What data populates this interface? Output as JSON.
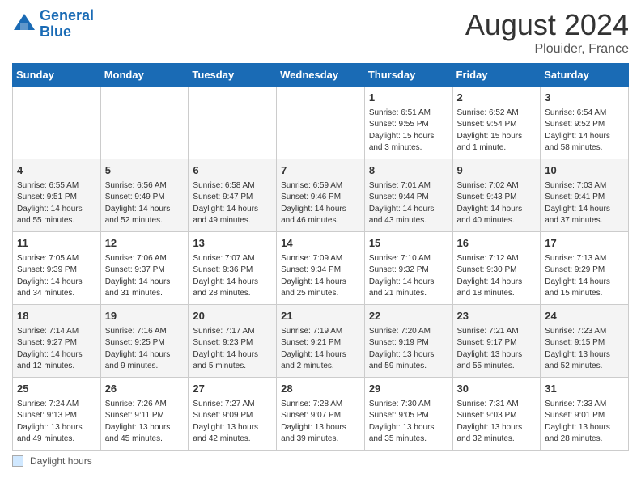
{
  "header": {
    "logo_line1": "General",
    "logo_line2": "Blue",
    "month_year": "August 2024",
    "location": "Plouider, France"
  },
  "legend": {
    "label": "Daylight hours"
  },
  "days_of_week": [
    "Sunday",
    "Monday",
    "Tuesday",
    "Wednesday",
    "Thursday",
    "Friday",
    "Saturday"
  ],
  "weeks": [
    [
      {
        "num": "",
        "info": ""
      },
      {
        "num": "",
        "info": ""
      },
      {
        "num": "",
        "info": ""
      },
      {
        "num": "",
        "info": ""
      },
      {
        "num": "1",
        "info": "Sunrise: 6:51 AM\nSunset: 9:55 PM\nDaylight: 15 hours\nand 3 minutes."
      },
      {
        "num": "2",
        "info": "Sunrise: 6:52 AM\nSunset: 9:54 PM\nDaylight: 15 hours\nand 1 minute."
      },
      {
        "num": "3",
        "info": "Sunrise: 6:54 AM\nSunset: 9:52 PM\nDaylight: 14 hours\nand 58 minutes."
      }
    ],
    [
      {
        "num": "4",
        "info": "Sunrise: 6:55 AM\nSunset: 9:51 PM\nDaylight: 14 hours\nand 55 minutes."
      },
      {
        "num": "5",
        "info": "Sunrise: 6:56 AM\nSunset: 9:49 PM\nDaylight: 14 hours\nand 52 minutes."
      },
      {
        "num": "6",
        "info": "Sunrise: 6:58 AM\nSunset: 9:47 PM\nDaylight: 14 hours\nand 49 minutes."
      },
      {
        "num": "7",
        "info": "Sunrise: 6:59 AM\nSunset: 9:46 PM\nDaylight: 14 hours\nand 46 minutes."
      },
      {
        "num": "8",
        "info": "Sunrise: 7:01 AM\nSunset: 9:44 PM\nDaylight: 14 hours\nand 43 minutes."
      },
      {
        "num": "9",
        "info": "Sunrise: 7:02 AM\nSunset: 9:43 PM\nDaylight: 14 hours\nand 40 minutes."
      },
      {
        "num": "10",
        "info": "Sunrise: 7:03 AM\nSunset: 9:41 PM\nDaylight: 14 hours\nand 37 minutes."
      }
    ],
    [
      {
        "num": "11",
        "info": "Sunrise: 7:05 AM\nSunset: 9:39 PM\nDaylight: 14 hours\nand 34 minutes."
      },
      {
        "num": "12",
        "info": "Sunrise: 7:06 AM\nSunset: 9:37 PM\nDaylight: 14 hours\nand 31 minutes."
      },
      {
        "num": "13",
        "info": "Sunrise: 7:07 AM\nSunset: 9:36 PM\nDaylight: 14 hours\nand 28 minutes."
      },
      {
        "num": "14",
        "info": "Sunrise: 7:09 AM\nSunset: 9:34 PM\nDaylight: 14 hours\nand 25 minutes."
      },
      {
        "num": "15",
        "info": "Sunrise: 7:10 AM\nSunset: 9:32 PM\nDaylight: 14 hours\nand 21 minutes."
      },
      {
        "num": "16",
        "info": "Sunrise: 7:12 AM\nSunset: 9:30 PM\nDaylight: 14 hours\nand 18 minutes."
      },
      {
        "num": "17",
        "info": "Sunrise: 7:13 AM\nSunset: 9:29 PM\nDaylight: 14 hours\nand 15 minutes."
      }
    ],
    [
      {
        "num": "18",
        "info": "Sunrise: 7:14 AM\nSunset: 9:27 PM\nDaylight: 14 hours\nand 12 minutes."
      },
      {
        "num": "19",
        "info": "Sunrise: 7:16 AM\nSunset: 9:25 PM\nDaylight: 14 hours\nand 9 minutes."
      },
      {
        "num": "20",
        "info": "Sunrise: 7:17 AM\nSunset: 9:23 PM\nDaylight: 14 hours\nand 5 minutes."
      },
      {
        "num": "21",
        "info": "Sunrise: 7:19 AM\nSunset: 9:21 PM\nDaylight: 14 hours\nand 2 minutes."
      },
      {
        "num": "22",
        "info": "Sunrise: 7:20 AM\nSunset: 9:19 PM\nDaylight: 13 hours\nand 59 minutes."
      },
      {
        "num": "23",
        "info": "Sunrise: 7:21 AM\nSunset: 9:17 PM\nDaylight: 13 hours\nand 55 minutes."
      },
      {
        "num": "24",
        "info": "Sunrise: 7:23 AM\nSunset: 9:15 PM\nDaylight: 13 hours\nand 52 minutes."
      }
    ],
    [
      {
        "num": "25",
        "info": "Sunrise: 7:24 AM\nSunset: 9:13 PM\nDaylight: 13 hours\nand 49 minutes."
      },
      {
        "num": "26",
        "info": "Sunrise: 7:26 AM\nSunset: 9:11 PM\nDaylight: 13 hours\nand 45 minutes."
      },
      {
        "num": "27",
        "info": "Sunrise: 7:27 AM\nSunset: 9:09 PM\nDaylight: 13 hours\nand 42 minutes."
      },
      {
        "num": "28",
        "info": "Sunrise: 7:28 AM\nSunset: 9:07 PM\nDaylight: 13 hours\nand 39 minutes."
      },
      {
        "num": "29",
        "info": "Sunrise: 7:30 AM\nSunset: 9:05 PM\nDaylight: 13 hours\nand 35 minutes."
      },
      {
        "num": "30",
        "info": "Sunrise: 7:31 AM\nSunset: 9:03 PM\nDaylight: 13 hours\nand 32 minutes."
      },
      {
        "num": "31",
        "info": "Sunrise: 7:33 AM\nSunset: 9:01 PM\nDaylight: 13 hours\nand 28 minutes."
      }
    ]
  ]
}
